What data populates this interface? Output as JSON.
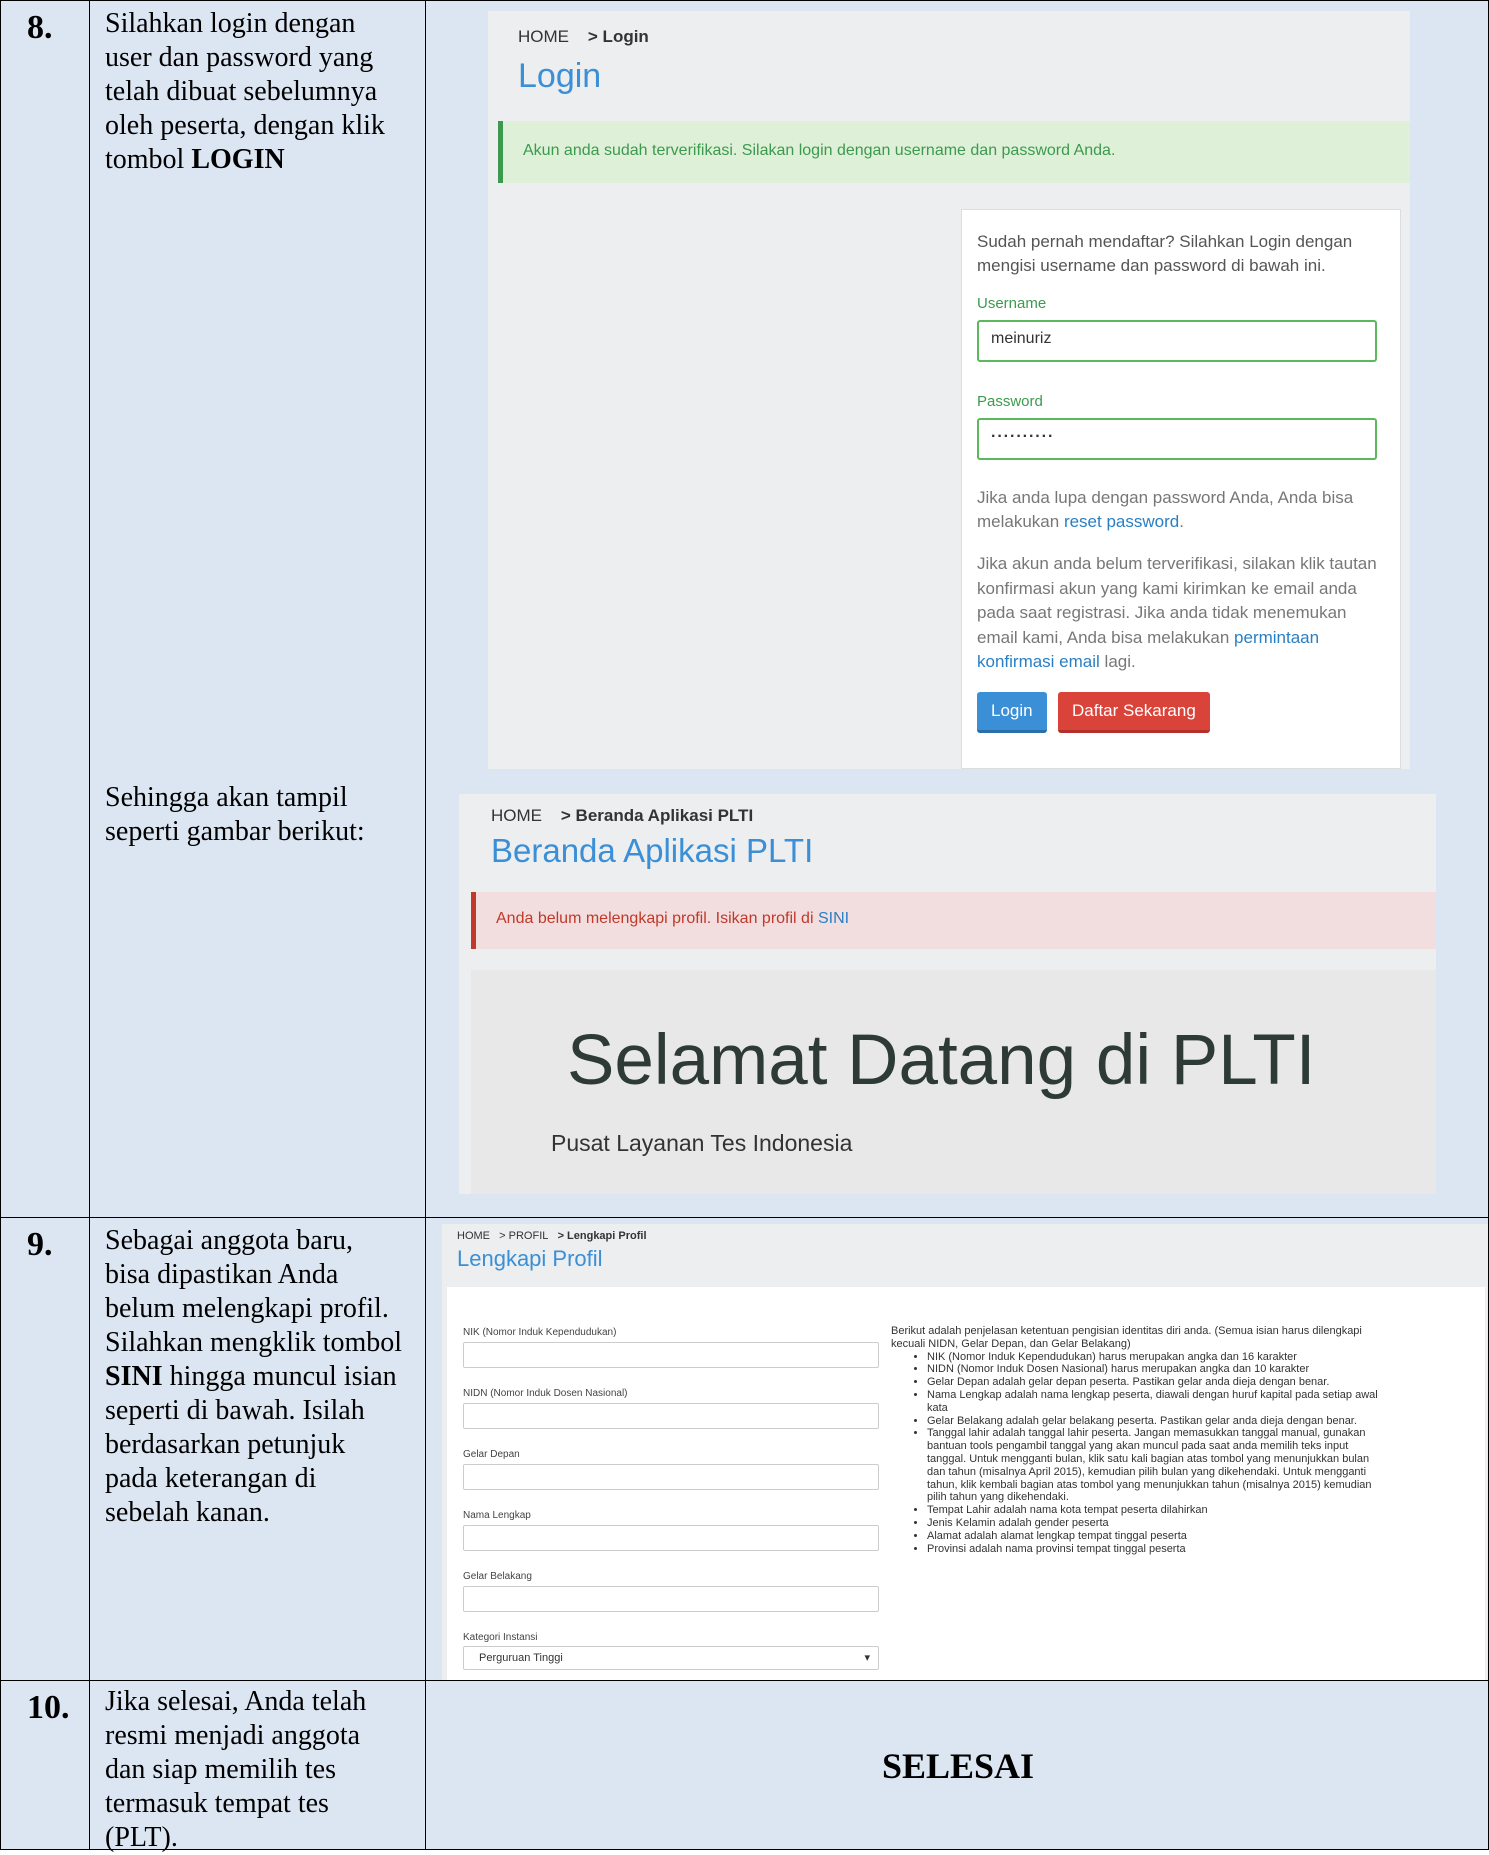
{
  "steps": [
    {
      "number": "8.",
      "description_html_parts": [
        {
          "text": "Silahkan login dengan user dan password yang telah dibuat sebelumnya oleh peserta, dengan klik tombol "
        },
        {
          "bold": "LOGIN"
        }
      ],
      "result_text": "Sehingga akan tampil seperti gambar berikut:"
    },
    {
      "number": "9.",
      "desc_part1": "Sebagai anggota baru, bisa dipastikan Anda belum melengkapi profil. Silahkan mengklik tombol ",
      "desc_bold": "SINI",
      "desc_part2": " hingga muncul isian seperti di bawah. Isilah berdasarkan petunjuk pada keterangan di sebelah kanan."
    },
    {
      "number": "10.",
      "description": "Jika selesai, Anda telah resmi menjadi anggota dan siap memilih tes termasuk tempat tes (PLT).",
      "result": "SELESAI"
    }
  ],
  "login_screen": {
    "breadcrumb_home": "HOME",
    "breadcrumb_current": "> Login",
    "title": "Login",
    "alert": "Akun anda sudah terverifikasi. Silakan login dengan username dan password Anda.",
    "intro": "Sudah pernah mendaftar? Silahkan Login dengan mengisi username dan password di bawah ini.",
    "username_label": "Username",
    "username_value": "meinuriz",
    "password_label": "Password",
    "password_value": "··········",
    "forgot_text": "Jika anda lupa dengan password Anda, Anda bisa melakukan ",
    "forgot_link": "reset password",
    "forgot_end": ".",
    "verify_text": "Jika akun anda belum terverifikasi, silakan klik tautan konfirmasi akun yang kami kirimkan ke email anda pada saat registrasi. Jika anda tidak menemukan email kami, Anda bisa melakukan ",
    "verify_link": "permintaan konfirmasi email",
    "verify_end": " lagi.",
    "login_button": "Login",
    "register_button": "Daftar Sekarang"
  },
  "home_screen": {
    "breadcrumb_home": "HOME",
    "breadcrumb_current": "> Beranda Aplikasi PLTI",
    "title": "Beranda Aplikasi PLTI",
    "alert_text": "Anda belum melengkapi profil. Isikan profil di ",
    "alert_link": "SINI",
    "jumbotron_title": "Selamat Datang di PLTI",
    "jumbotron_subtitle": "Pusat Layanan Tes Indonesia"
  },
  "profile_screen": {
    "breadcrumb_home": "HOME",
    "breadcrumb_mid": "> PROFIL",
    "breadcrumb_current": "> Lengkapi Profil",
    "title": "Lengkapi Profil",
    "fields": [
      "NIK (Nomor Induk Kependudukan)",
      "NIDN (Nomor Induk Dosen Nasional)",
      "Gelar Depan",
      "Nama Lengkap",
      "Gelar Belakang",
      "Kategori Instansi"
    ],
    "select_value": "Perguruan Tinggi",
    "select_caret": "▾",
    "rules_intro": "Berikut adalah penjelasan ketentuan pengisian identitas diri anda. (Semua isian harus dilengkapi kecuali NIDN, Gelar Depan, dan Gelar Belakang)",
    "rules": [
      "NIK (Nomor Induk Kependudukan) harus merupakan angka dan 16 karakter",
      "NIDN (Nomor Induk Dosen Nasional) harus merupakan angka dan 10 karakter",
      "Gelar Depan adalah gelar depan peserta. Pastikan gelar anda dieja dengan benar.",
      "Nama Lengkap adalah nama lengkap peserta, diawali dengan huruf kapital pada setiap awal kata",
      "Gelar Belakang adalah gelar belakang peserta. Pastikan gelar anda dieja dengan benar.",
      "Tanggal lahir adalah tanggal lahir peserta. Jangan memasukkan tanggal manual, gunakan bantuan tools pengambil tanggal yang akan muncul pada saat anda memilih teks input tanggal. Untuk mengganti bulan, klik satu kali bagian atas tombol yang menunjukkan bulan dan tahun (misalnya April 2015), kemudian pilih bulan yang dikehendaki. Untuk mengganti tahun, klik kembali bagian atas tombol yang menunjukkan tahun (misalnya 2015) kemudian pilih tahun yang dikehendaki.",
      "Tempat Lahir adalah nama kota tempat peserta dilahirkan",
      "Jenis Kelamin adalah gender peserta",
      "Alamat adalah alamat lengkap tempat tinggal peserta",
      "Provinsi adalah nama provinsi tempat tinggal peserta"
    ]
  }
}
